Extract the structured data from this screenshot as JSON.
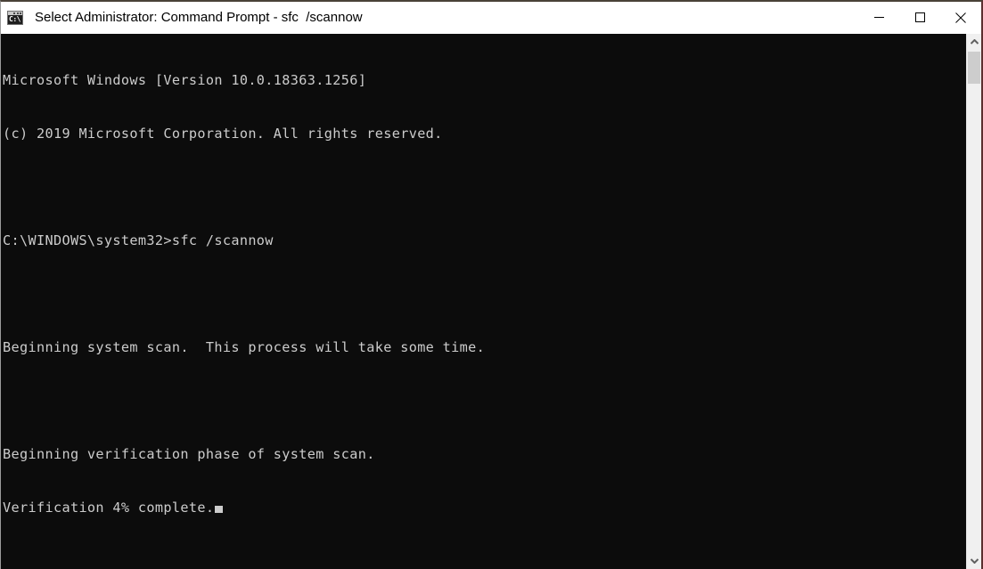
{
  "window": {
    "title": "Select Administrator: Command Prompt - sfc  /scannow",
    "icon": "cmd-console-icon",
    "icon_text": "C:\\",
    "border_color": "#5c3030",
    "titlebar_bg": "#ffffff"
  },
  "controls": {
    "minimize_label": "Minimize",
    "maximize_label": "Maximize",
    "close_label": "Close"
  },
  "console": {
    "background": "#0c0c0c",
    "foreground": "#cccccc",
    "lines": [
      "Microsoft Windows [Version 10.0.18363.1256]",
      "(c) 2019 Microsoft Corporation. All rights reserved.",
      "",
      "C:\\WINDOWS\\system32>sfc /scannow",
      "",
      "Beginning system scan.  This process will take some time.",
      "",
      "Beginning verification phase of system scan.",
      "Verification 4% complete."
    ],
    "prompt_path": "C:\\WINDOWS\\system32>",
    "command": "sfc /scannow",
    "os_version": "10.0.18363.1256",
    "copyright_year": "2019",
    "progress_percent": "4%",
    "cursor_visible": true
  },
  "scrollbar": {
    "up_arrow": "chevron-up-icon",
    "down_arrow": "chevron-down-icon",
    "thumb_color": "#cdcdcd",
    "track_color": "#f0f0f0"
  }
}
